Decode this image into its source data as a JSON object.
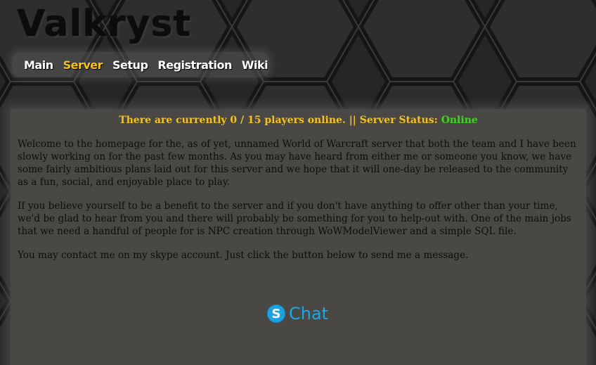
{
  "site": {
    "title": "Valkryst"
  },
  "nav": {
    "items": [
      {
        "label": "Main",
        "active": false
      },
      {
        "label": "Server",
        "active": true
      },
      {
        "label": "Setup",
        "active": false
      },
      {
        "label": "Registration",
        "active": false
      },
      {
        "label": "Wiki",
        "active": false
      }
    ]
  },
  "status": {
    "prefix": "There are currently 0 / 15 players online. || Server Status: ",
    "state": "Online"
  },
  "content": {
    "paragraphs": [
      "Welcome to the homepage for the, as of yet, unnamed World of Warcraft server that both the team and I have been slowly working on for the past few months. As you may have heard from either me or someone you know, we have some fairly ambitious plans laid out for this server and we hope that it will one-day be released to the community as a fun, social, and enjoyable place to play.",
      "If you believe yourself to be a benefit to the server and if you don't have anything to offer other than your time, we'd be glad to hear from you and there will probably be something for you to help-out with. One of the main jobs that we need a handful of people for is NPC creation through WoWModelViewer and a simple SQL file.",
      "You may contact me on my skype account. Just click the button below to send me a message."
    ]
  },
  "chat_button": {
    "icon": "skype-icon",
    "icon_glyph": "S",
    "label": "Chat"
  },
  "colors": {
    "accent": "#f6c21c",
    "online": "#3ed61e",
    "skype": "#1da1e0",
    "panel": "#4a4845"
  }
}
